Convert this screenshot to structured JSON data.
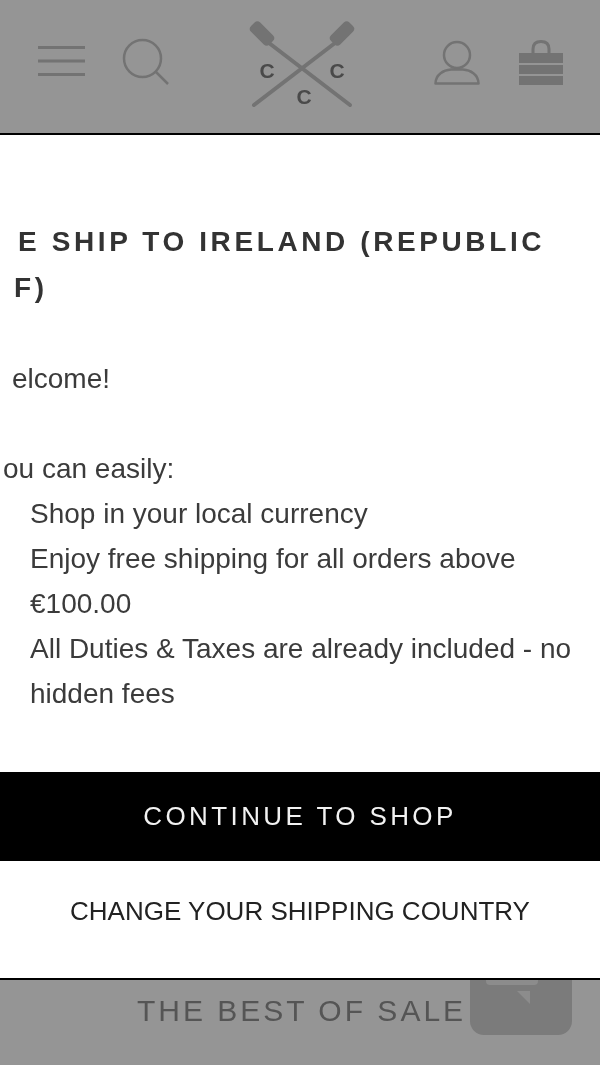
{
  "header": {
    "logo_letters": [
      "C",
      "C",
      "C"
    ]
  },
  "dialog": {
    "title_lines": [
      "E SHIP TO IRELAND (REPUBLIC",
      "F)"
    ],
    "greeting": "elcome!",
    "intro": "ou can easily:",
    "benefits": [
      "Shop in your local currency",
      "Enjoy free shipping for all orders above €100.00",
      "All Duties & Taxes are already included - no hidden fees"
    ],
    "buttons": [
      {
        "label": "CONTINUE TO SHOP",
        "kind": "primary"
      },
      {
        "label": "CHANGE YOUR SHIPPING COUNTRY",
        "kind": "secondary"
      }
    ]
  },
  "page_behind": {
    "section_title": "THE BEST OF SALE"
  }
}
